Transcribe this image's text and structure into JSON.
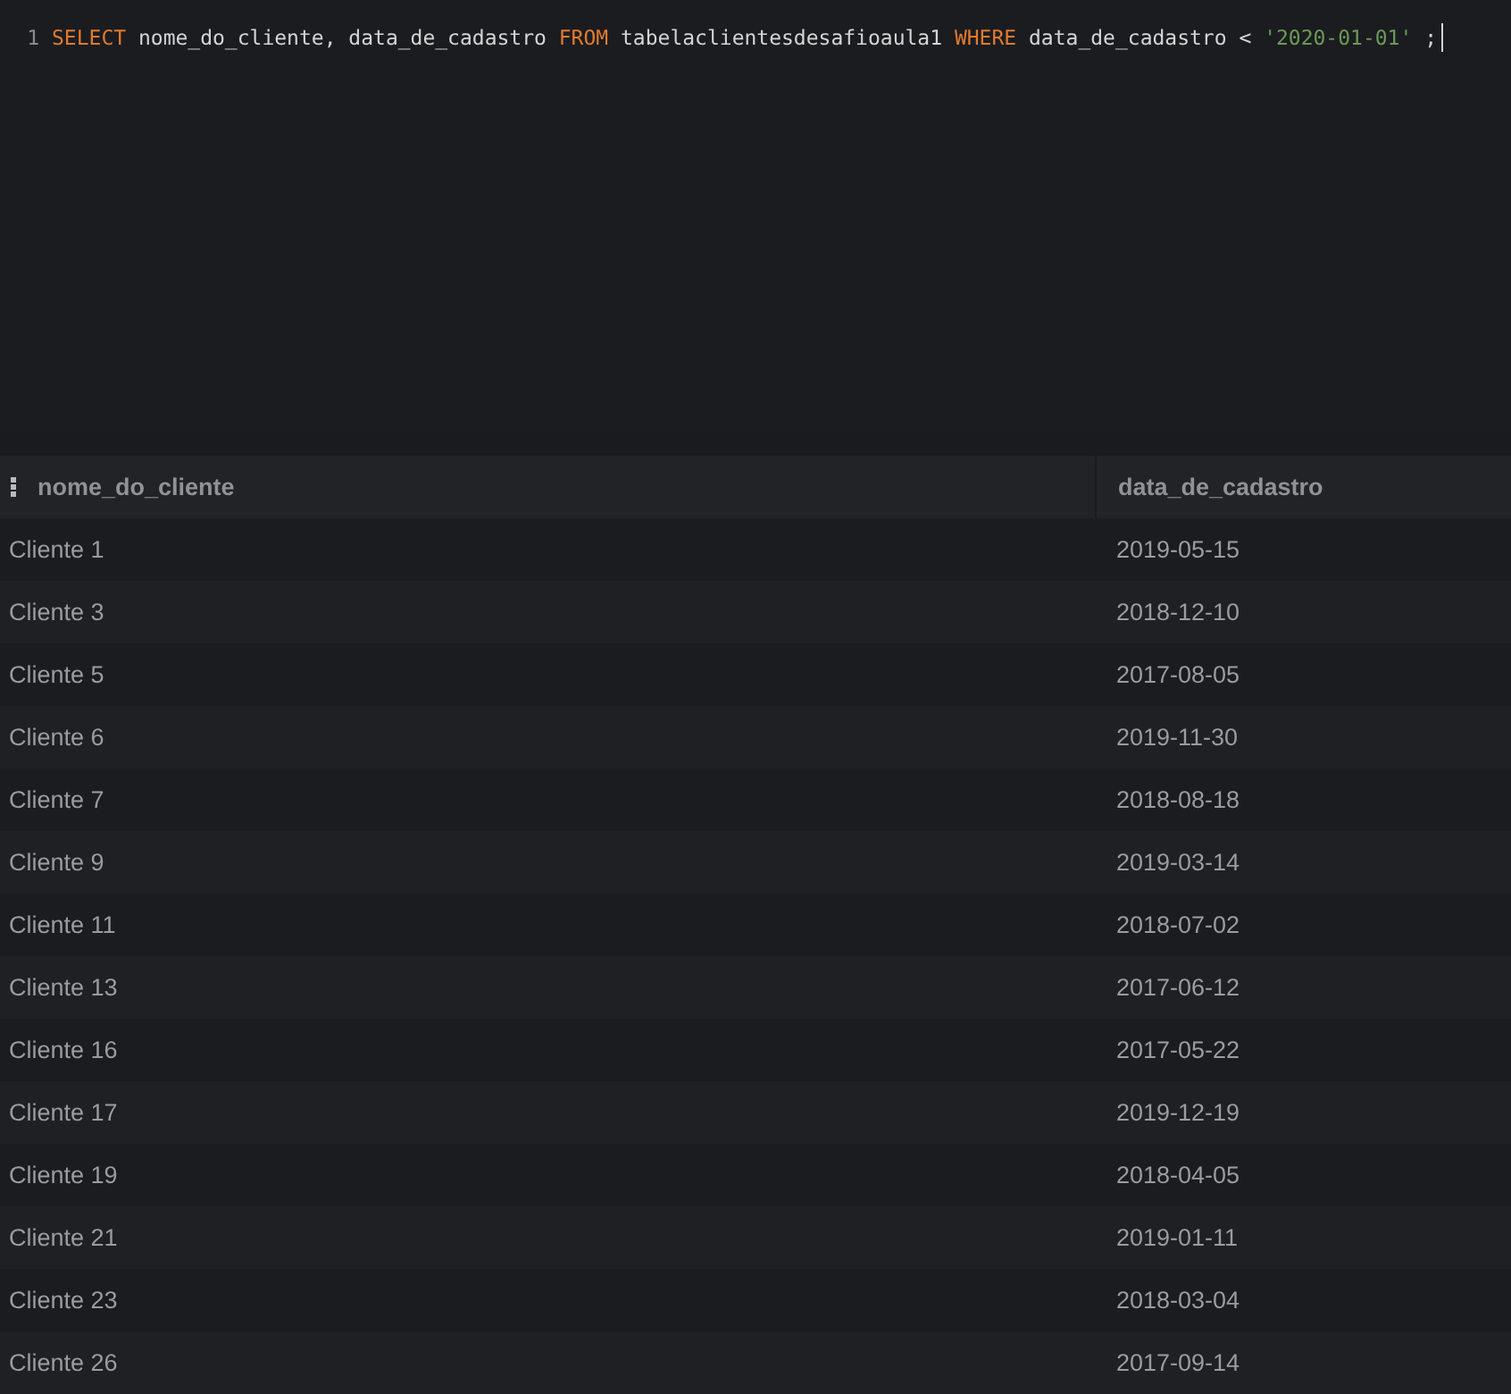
{
  "editor": {
    "lines": [
      {
        "number": "1",
        "tokens": [
          {
            "kind": "keyword",
            "text": "SELECT"
          },
          {
            "kind": "plain",
            "text": " nome_do_cliente, data_de_cadastro "
          },
          {
            "kind": "keyword",
            "text": "FROM"
          },
          {
            "kind": "plain",
            "text": " tabelaclientesdesafioaula1 "
          },
          {
            "kind": "keyword",
            "text": "WHERE"
          },
          {
            "kind": "plain",
            "text": " data_de_cadastro < "
          },
          {
            "kind": "string",
            "text": "'2020-01-01'"
          },
          {
            "kind": "plain",
            "text": " ;"
          }
        ]
      }
    ]
  },
  "results": {
    "columns": [
      "nome_do_cliente",
      "data_de_cadastro"
    ],
    "rows": [
      [
        "Cliente 1",
        "2019-05-15"
      ],
      [
        "Cliente 3",
        "2018-12-10"
      ],
      [
        "Cliente 5",
        "2017-08-05"
      ],
      [
        "Cliente 6",
        "2019-11-30"
      ],
      [
        "Cliente 7",
        "2018-08-18"
      ],
      [
        "Cliente 9",
        "2019-03-14"
      ],
      [
        "Cliente 11",
        "2018-07-02"
      ],
      [
        "Cliente 13",
        "2017-06-12"
      ],
      [
        "Cliente 16",
        "2017-05-22"
      ],
      [
        "Cliente 17",
        "2019-12-19"
      ],
      [
        "Cliente 19",
        "2018-04-05"
      ],
      [
        "Cliente 21",
        "2019-01-11"
      ],
      [
        "Cliente 23",
        "2018-03-04"
      ],
      [
        "Cliente 26",
        "2017-09-14"
      ]
    ]
  }
}
